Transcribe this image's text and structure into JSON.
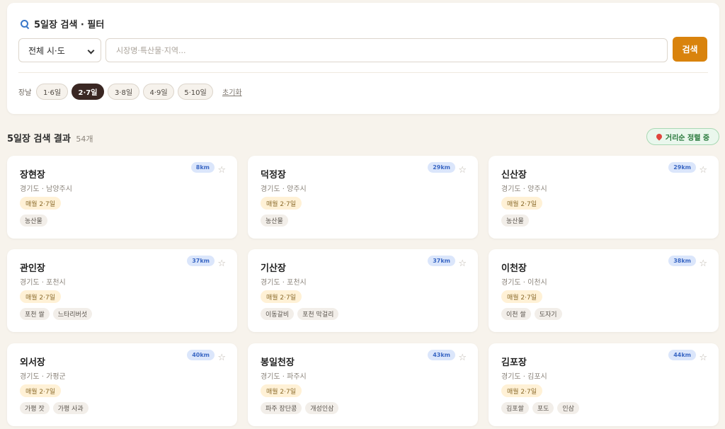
{
  "filter": {
    "title": "5일장 검색 · 필터",
    "region_select": "전체 시·도",
    "search_placeholder": "시장명·특산물·지역...",
    "search_button": "검색",
    "market_day_label": "장날",
    "day_chips": [
      {
        "label": "1·6일",
        "active": false
      },
      {
        "label": "2·7일",
        "active": true
      },
      {
        "label": "3·8일",
        "active": false
      },
      {
        "label": "4·9일",
        "active": false
      },
      {
        "label": "5·10일",
        "active": false
      }
    ],
    "reset_label": "초기화"
  },
  "results": {
    "title": "5일장 검색 결과",
    "count": "54개",
    "sort_badge": "거리순 정렬 중"
  },
  "markets": [
    {
      "name": "장현장",
      "location": "경기도 · 남양주시",
      "day": "매월 2·7일",
      "distance": "8km",
      "tags": [
        "농산물"
      ]
    },
    {
      "name": "덕정장",
      "location": "경기도 · 양주시",
      "day": "매월 2·7일",
      "distance": "29km",
      "tags": [
        "농산물"
      ]
    },
    {
      "name": "신산장",
      "location": "경기도 · 양주시",
      "day": "매월 2·7일",
      "distance": "29km",
      "tags": [
        "농산물"
      ]
    },
    {
      "name": "관인장",
      "location": "경기도 · 포천시",
      "day": "매월 2·7일",
      "distance": "37km",
      "tags": [
        "포천 쌀",
        "느타리버섯"
      ]
    },
    {
      "name": "기산장",
      "location": "경기도 · 포천시",
      "day": "매월 2·7일",
      "distance": "37km",
      "tags": [
        "이동갈비",
        "포천 막걸리"
      ]
    },
    {
      "name": "이천장",
      "location": "경기도 · 이천시",
      "day": "매월 2·7일",
      "distance": "38km",
      "tags": [
        "이천 쌀",
        "도자기"
      ]
    },
    {
      "name": "외서장",
      "location": "경기도 · 가평군",
      "day": "매월 2·7일",
      "distance": "40km",
      "tags": [
        "가평 잣",
        "가평 사과"
      ]
    },
    {
      "name": "봉일천장",
      "location": "경기도 · 파주시",
      "day": "매월 2·7일",
      "distance": "43km",
      "tags": [
        "파주 장단콩",
        "개성인삼"
      ]
    },
    {
      "name": "김포장",
      "location": "경기도 · 김포시",
      "day": "매월 2·7일",
      "distance": "44km",
      "tags": [
        "김포쌀",
        "포도",
        "인삼"
      ]
    }
  ]
}
